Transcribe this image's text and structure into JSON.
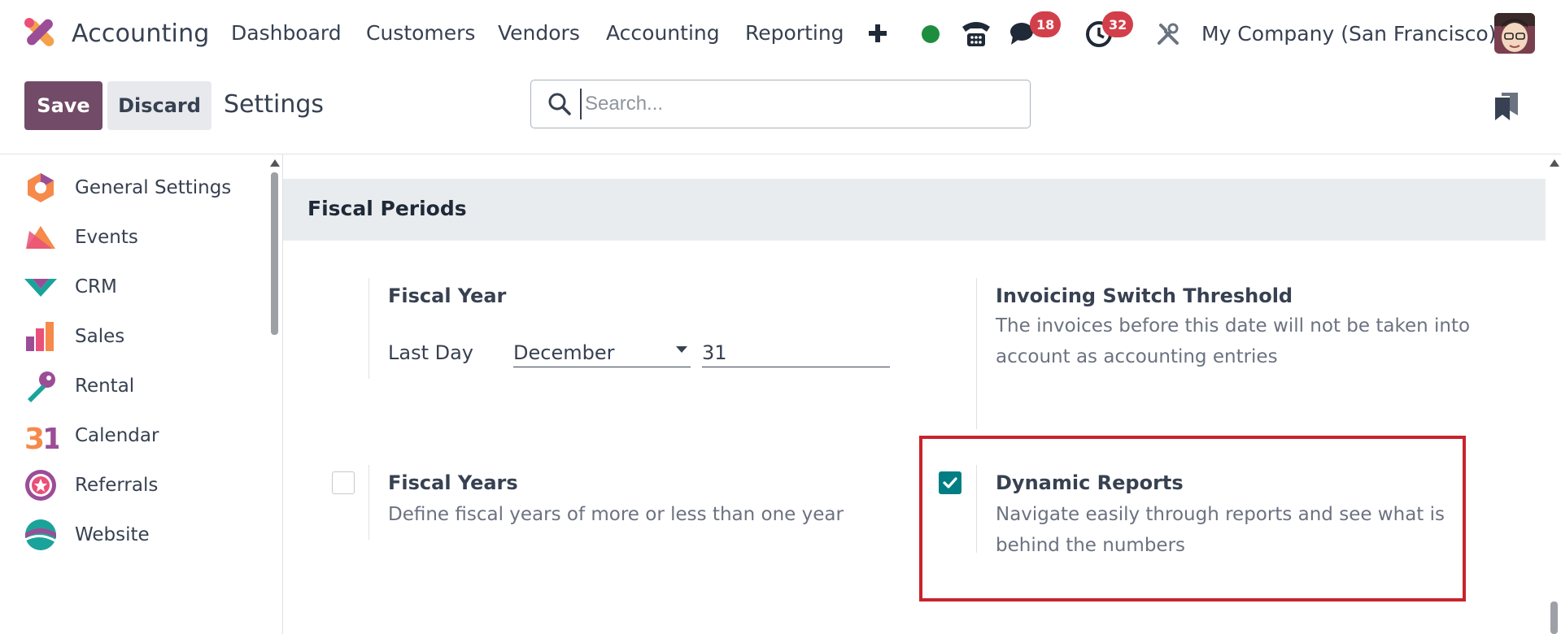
{
  "navbar": {
    "app_name": "Accounting",
    "menu": [
      "Dashboard",
      "Customers",
      "Vendors",
      "Accounting",
      "Reporting"
    ],
    "messages_badge": "18",
    "activities_badge": "32",
    "company": "My Company (San Francisco)",
    "status_color": "#1e8e3e"
  },
  "control": {
    "save_label": "Save",
    "discard_label": "Discard",
    "breadcrumb": "Settings",
    "search_placeholder": "Search..."
  },
  "sidebar": {
    "items": [
      {
        "label": "General Settings",
        "icon": "general-settings-icon"
      },
      {
        "label": "Events",
        "icon": "events-icon"
      },
      {
        "label": "CRM",
        "icon": "crm-icon"
      },
      {
        "label": "Sales",
        "icon": "sales-icon"
      },
      {
        "label": "Rental",
        "icon": "rental-icon"
      },
      {
        "label": "Calendar",
        "icon": "calendar-icon"
      },
      {
        "label": "Referrals",
        "icon": "referrals-icon"
      },
      {
        "label": "Website",
        "icon": "website-icon"
      }
    ]
  },
  "main": {
    "section_title": "Fiscal Periods",
    "fiscal_year": {
      "title": "Fiscal Year",
      "last_day_label": "Last Day",
      "month": "December",
      "day": "31"
    },
    "invoicing_threshold": {
      "title": "Invoicing Switch Threshold",
      "desc_line1": "The invoices before this date will not be taken into",
      "desc_line2": "account as accounting entries"
    },
    "fiscal_years": {
      "title": "Fiscal Years",
      "desc": "Define fiscal years of more or less than one year",
      "checked": false
    },
    "dynamic_reports": {
      "title": "Dynamic Reports",
      "desc_line1": "Navigate easily through reports and see what is",
      "desc_line2": "behind the numbers",
      "checked": true
    }
  }
}
